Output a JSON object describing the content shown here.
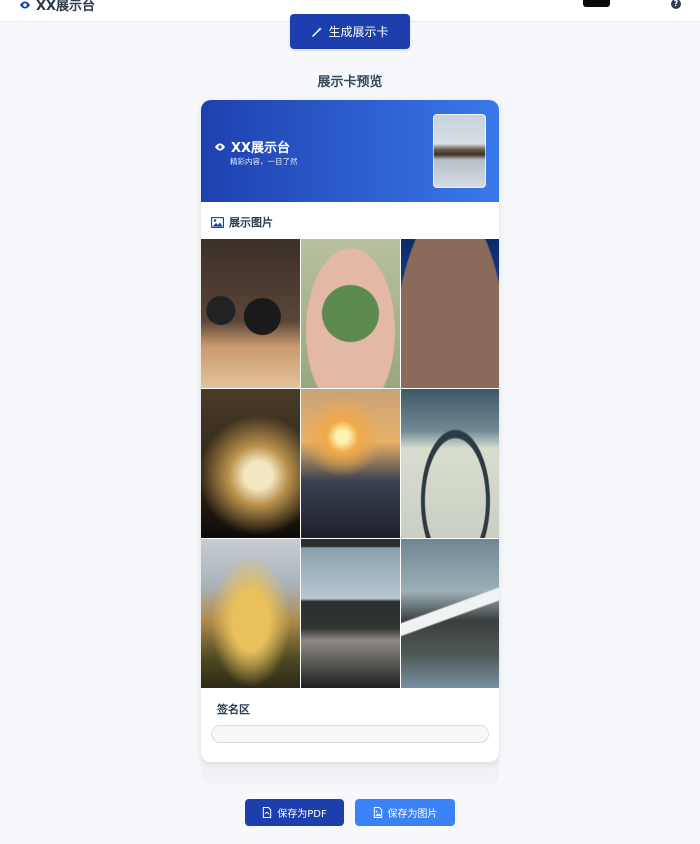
{
  "header": {
    "brand_title": "XX展示台",
    "help_glyph": "?"
  },
  "actions": {
    "generate_label": "生成展示卡"
  },
  "preview": {
    "title": "展示卡预览"
  },
  "card": {
    "title": "XX展示台",
    "subtitle": "精彩内容，一目了然",
    "gallery_label": "展示图片",
    "signature_label": "签名区",
    "images": [
      "camera-photo",
      "green-plant-in-hands-photo",
      "star-trails-night-sky-photo",
      "concert-crowd-photo",
      "sunset-skatepark-photo",
      "map-on-table-photo",
      "boat-bow-photo",
      "window-sleeping-person-photo",
      "snowy-mountain-photo"
    ]
  },
  "footer": {
    "save_pdf_label": "保存为PDF",
    "save_image_label": "保存为图片"
  },
  "colors": {
    "primary": "#1d3fae",
    "secondary": "#3b82f6",
    "header_gradient_start": "#1e40af",
    "header_gradient_end": "#3a78ea",
    "background": "#f6f8fb"
  }
}
